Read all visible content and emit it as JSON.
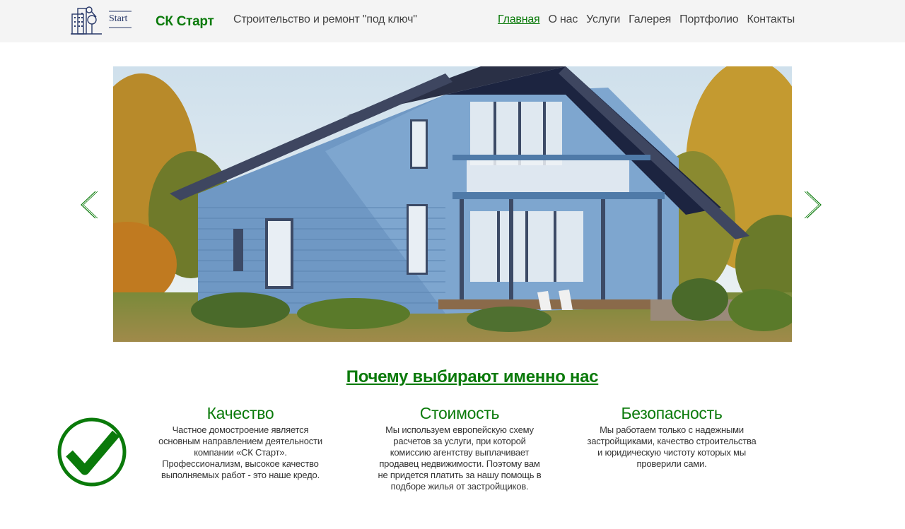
{
  "header": {
    "logo_text": "Start",
    "brand": "СК Старт",
    "tagline": "Строительство и ремонт \"под ключ\"",
    "nav": [
      {
        "label": "Главная",
        "active": true
      },
      {
        "label": "О нас",
        "active": false
      },
      {
        "label": "Услуги",
        "active": false
      },
      {
        "label": "Галерея",
        "active": false
      },
      {
        "label": "Портфолио",
        "active": false
      },
      {
        "label": "Контакты",
        "active": false
      }
    ]
  },
  "slider": {
    "image": "house-photo",
    "prev_icon": "chevron-left-icon",
    "next_icon": "chevron-right-icon"
  },
  "why": {
    "title": "Почему выбирают именно нас",
    "icon": "checkmark-circle-icon",
    "features": [
      {
        "title": "Качество",
        "text": "Частное домостроение является основным направлением деятельности компании «СК Старт». Профессионализм, высокое качество выполняемых работ - это наше кредо."
      },
      {
        "title": "Стоимость",
        "text": "Мы используем европейскую схему расчетов за услуги, при которой комиссию агентству выплачивает продавец недвижимости. Поэтому вам не придется платить за нашу помощь в подборе жилья от застройщиков."
      },
      {
        "title": "Безопасность",
        "text": "Мы работаем только с надежными застройщиками, качество строительства и юридическую чистоту которых мы проверили сами."
      }
    ]
  },
  "colors": {
    "accent": "#0a7a0a",
    "header_bg": "#f4f4f4",
    "text": "#333333"
  }
}
